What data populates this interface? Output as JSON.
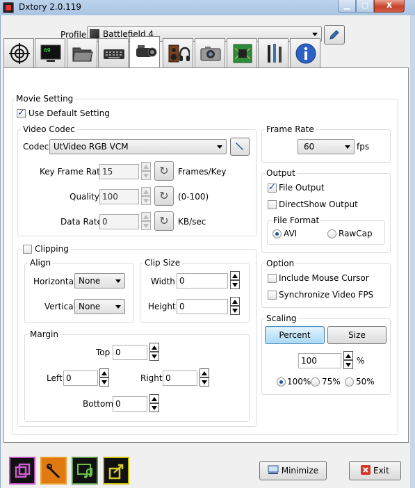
{
  "window": {
    "title": "Dxtory 2.0.119",
    "close_glyph": "x"
  },
  "profile": {
    "label": "Profile",
    "value": "Battlefield 4"
  },
  "tabs": [
    {
      "icon": "crosshair-icon"
    },
    {
      "icon": "monitor-icon",
      "text": "69"
    },
    {
      "icon": "folder-icon"
    },
    {
      "icon": "keyboard-icon"
    },
    {
      "icon": "camcorder-icon"
    },
    {
      "icon": "speaker-icon"
    },
    {
      "icon": "headphones-icon"
    },
    {
      "icon": "camera-icon"
    },
    {
      "icon": "chip-icon"
    },
    {
      "icon": "tools-icon"
    },
    {
      "icon": "info-icon"
    }
  ],
  "movie_setting": {
    "title": "Movie Setting",
    "use_default_label": "Use Default Setting",
    "use_default_checked": true
  },
  "video_codec": {
    "title": "Video Codec",
    "codec_label": "Codec",
    "codec_value": "UtVideo RGB VCM",
    "key_frame_label": "Key Frame Rate",
    "key_frame_value": "15",
    "key_frame_unit": "Frames/Key",
    "quality_label": "Quality",
    "quality_value": "100",
    "quality_unit": "(0-100)",
    "data_rate_label": "Data Rate",
    "data_rate_value": "0",
    "data_rate_unit": "KB/sec"
  },
  "frame_rate": {
    "title": "Frame Rate",
    "value": "60",
    "unit": "fps"
  },
  "output": {
    "title": "Output",
    "file_output_label": "File Output",
    "file_output_checked": true,
    "directshow_label": "DirectShow Output",
    "directshow_checked": false,
    "file_format_title": "File Format",
    "avi_label": "AVI",
    "rawcap_label": "RawCap",
    "selected_format": "AVI"
  },
  "clipping": {
    "title": "Clipping",
    "checked": false,
    "align_title": "Align",
    "horizontal_label": "Horizontal",
    "horizontal_value": "None",
    "vertical_label": "Vertical",
    "vertical_value": "None",
    "clip_size_title": "Clip Size",
    "width_label": "Width",
    "width_value": "0",
    "height_label": "Height",
    "height_value": "0",
    "margin_title": "Margin",
    "top_label": "Top",
    "top_value": "0",
    "left_label": "Left",
    "left_value": "0",
    "right_label": "Right",
    "right_value": "0",
    "bottom_label": "Bottom",
    "bottom_value": "0"
  },
  "option": {
    "title": "Option",
    "include_cursor_label": "Include Mouse Cursor",
    "include_cursor_checked": false,
    "sync_fps_label": "Synchronize Video FPS",
    "sync_fps_checked": false
  },
  "scaling": {
    "title": "Scaling",
    "percent_label": "Percent",
    "size_label": "Size",
    "selected_mode": "Percent",
    "value": "100",
    "unit": "%",
    "preset_100": "100%",
    "preset_75": "75%",
    "preset_50": "50%",
    "selected_preset": "100%"
  },
  "bottom_bar": {
    "icons": [
      "windows-icon",
      "wrench-icon",
      "music-monitor-icon",
      "export-icon"
    ],
    "minimize_label": "Minimize",
    "exit_label": "Exit"
  },
  "colors": {
    "accent": "#3c7fb1",
    "selected_button": "#a7d9f5",
    "exit_icon": "#d23a2a"
  }
}
